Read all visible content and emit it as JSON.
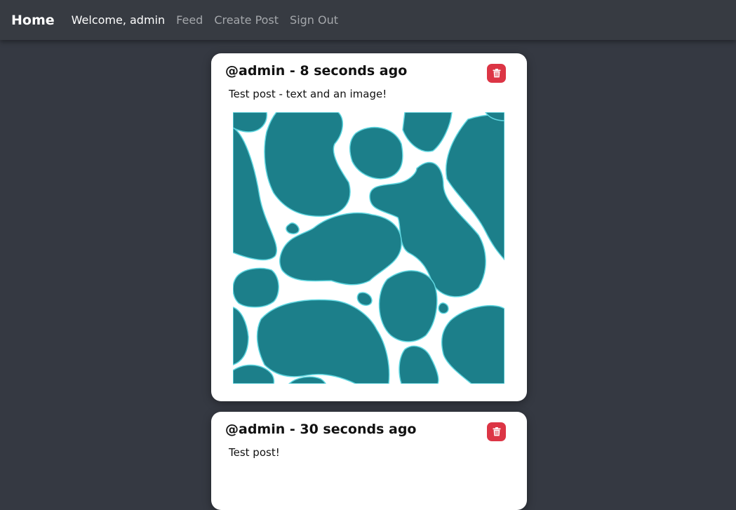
{
  "nav": {
    "brand": "Home",
    "welcome": "Welcome, admin",
    "links": [
      "Feed",
      "Create Post",
      "Sign Out"
    ]
  },
  "posts": [
    {
      "header": "@admin - 8 seconds ago",
      "text": "Test post - text and an image!",
      "image": "teal-cow-spot-pattern"
    },
    {
      "header": "@admin - 30 seconds ago",
      "text": "Test post!"
    }
  ],
  "colors": {
    "background": "#353942",
    "navbar": "#373b42",
    "delete": "#dc3545",
    "image_spots": "#1c7f8a"
  },
  "icons": {
    "delete": "trash-icon"
  }
}
